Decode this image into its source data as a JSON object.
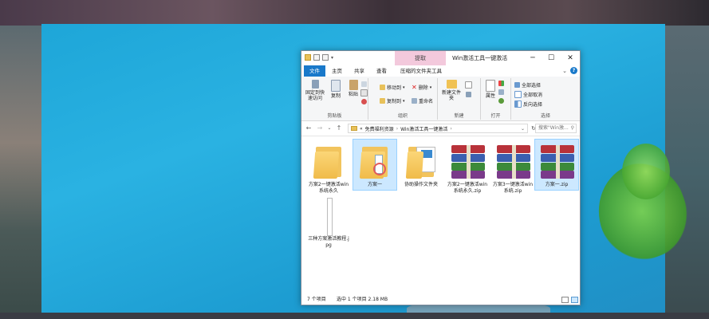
{
  "window": {
    "title": "Win激活工具一键激活",
    "context_tab": "提取",
    "minimize": "─",
    "maximize": "☐",
    "close": "✕"
  },
  "tabs": {
    "file": "文件",
    "home": "主页",
    "share": "共享",
    "view": "查看",
    "compressed_tools": "压缩的文件夹工具",
    "help": "?",
    "collapse": "⌄"
  },
  "ribbon": {
    "clipboard": {
      "pin_label": "固定到快速访问",
      "copy_label": "复制",
      "paste_label": "粘贴",
      "cut_label": "",
      "group_label": "剪贴板"
    },
    "organize": {
      "move_to": "移动到",
      "copy_to": "复制到",
      "delete": "删除",
      "rename": "重命名",
      "group_label": "组织"
    },
    "new": {
      "new_folder": "新建文件夹",
      "group_label": "新建"
    },
    "open": {
      "properties": "属性",
      "group_label": "打开"
    },
    "select": {
      "select_all": "全部选择",
      "select_none": "全部取消",
      "invert": "反向选择",
      "group_label": "选择"
    }
  },
  "address": {
    "back": "←",
    "forward": "→",
    "recent": "⌄",
    "up": "↑",
    "crumbs": [
      "«",
      "免费福利资源",
      "›",
      "Win激活工具一键激活",
      "›"
    ],
    "dropdown": "⌄",
    "refresh": "↻",
    "search_placeholder": "搜索\"Win激...",
    "search_icon": "⚲"
  },
  "files": [
    {
      "name": "方案2一键激活win系统永久",
      "type": "folder",
      "selected": false
    },
    {
      "name": "方案一",
      "type": "folder",
      "selected": true
    },
    {
      "name": "协助操作文件夹",
      "type": "folder-docs",
      "selected": false
    },
    {
      "name": "方案2一键激活win系统永久.zip",
      "type": "rar",
      "selected": false
    },
    {
      "name": "方案3一键激活win系统.zip",
      "type": "rar",
      "selected": false
    },
    {
      "name": "方案一.zip",
      "type": "rar",
      "selected": true
    },
    {
      "name": "三种方案激活教程.jpg",
      "type": "image",
      "selected": false
    }
  ],
  "status": {
    "count": "7 个项目",
    "selected": "选中 1 个项目  2.18 MB"
  },
  "colors": {
    "accent": "#1979ca",
    "selection": "#cce8ff",
    "context_tab": "#f3c9dc"
  }
}
